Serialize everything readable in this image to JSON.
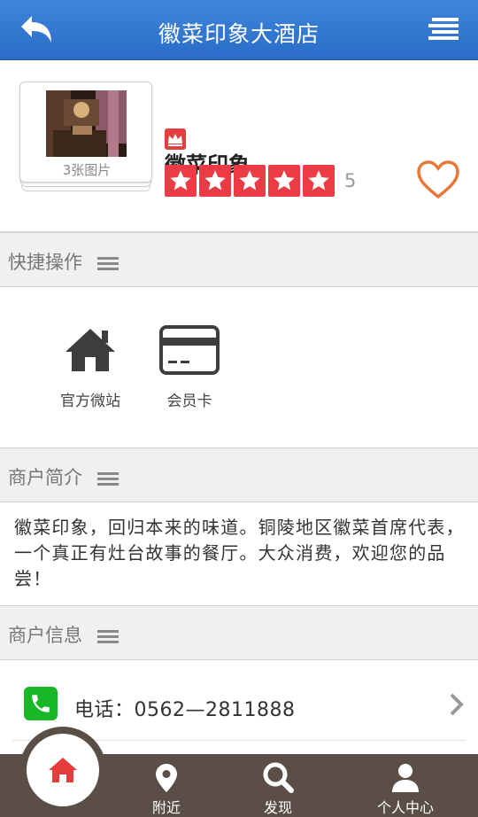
{
  "header": {
    "title": "徽菜印象大酒店"
  },
  "store": {
    "name": "徽菜印象",
    "photo_caption": "3张图片",
    "rating": "5",
    "stars": 5
  },
  "quick_actions": {
    "title": "快捷操作",
    "items": [
      {
        "label": "官方微站",
        "icon": "home-icon"
      },
      {
        "label": "会员卡",
        "icon": "card-icon"
      }
    ]
  },
  "intro": {
    "title": "商户简介",
    "text": "徽菜印象，回归本来的味道。铜陵地区徽菜首席代表，一个真正有灶台故事的餐厅。大众消费，欢迎您的品尝！"
  },
  "info": {
    "title": "商户信息",
    "phone": "电话：0562—2811888"
  },
  "tabbar": {
    "items": [
      {
        "label": "附近",
        "icon": "location-pin-icon"
      },
      {
        "label": "发现",
        "icon": "search-icon"
      },
      {
        "label": "个人中心",
        "icon": "user-icon"
      }
    ]
  },
  "colors": {
    "header": "#2f74d0",
    "star": "#ec3b44",
    "heart": "#e9773a",
    "phone": "#19b728",
    "tabbar": "#5a4e46",
    "home_icon": "#e63c3c"
  }
}
